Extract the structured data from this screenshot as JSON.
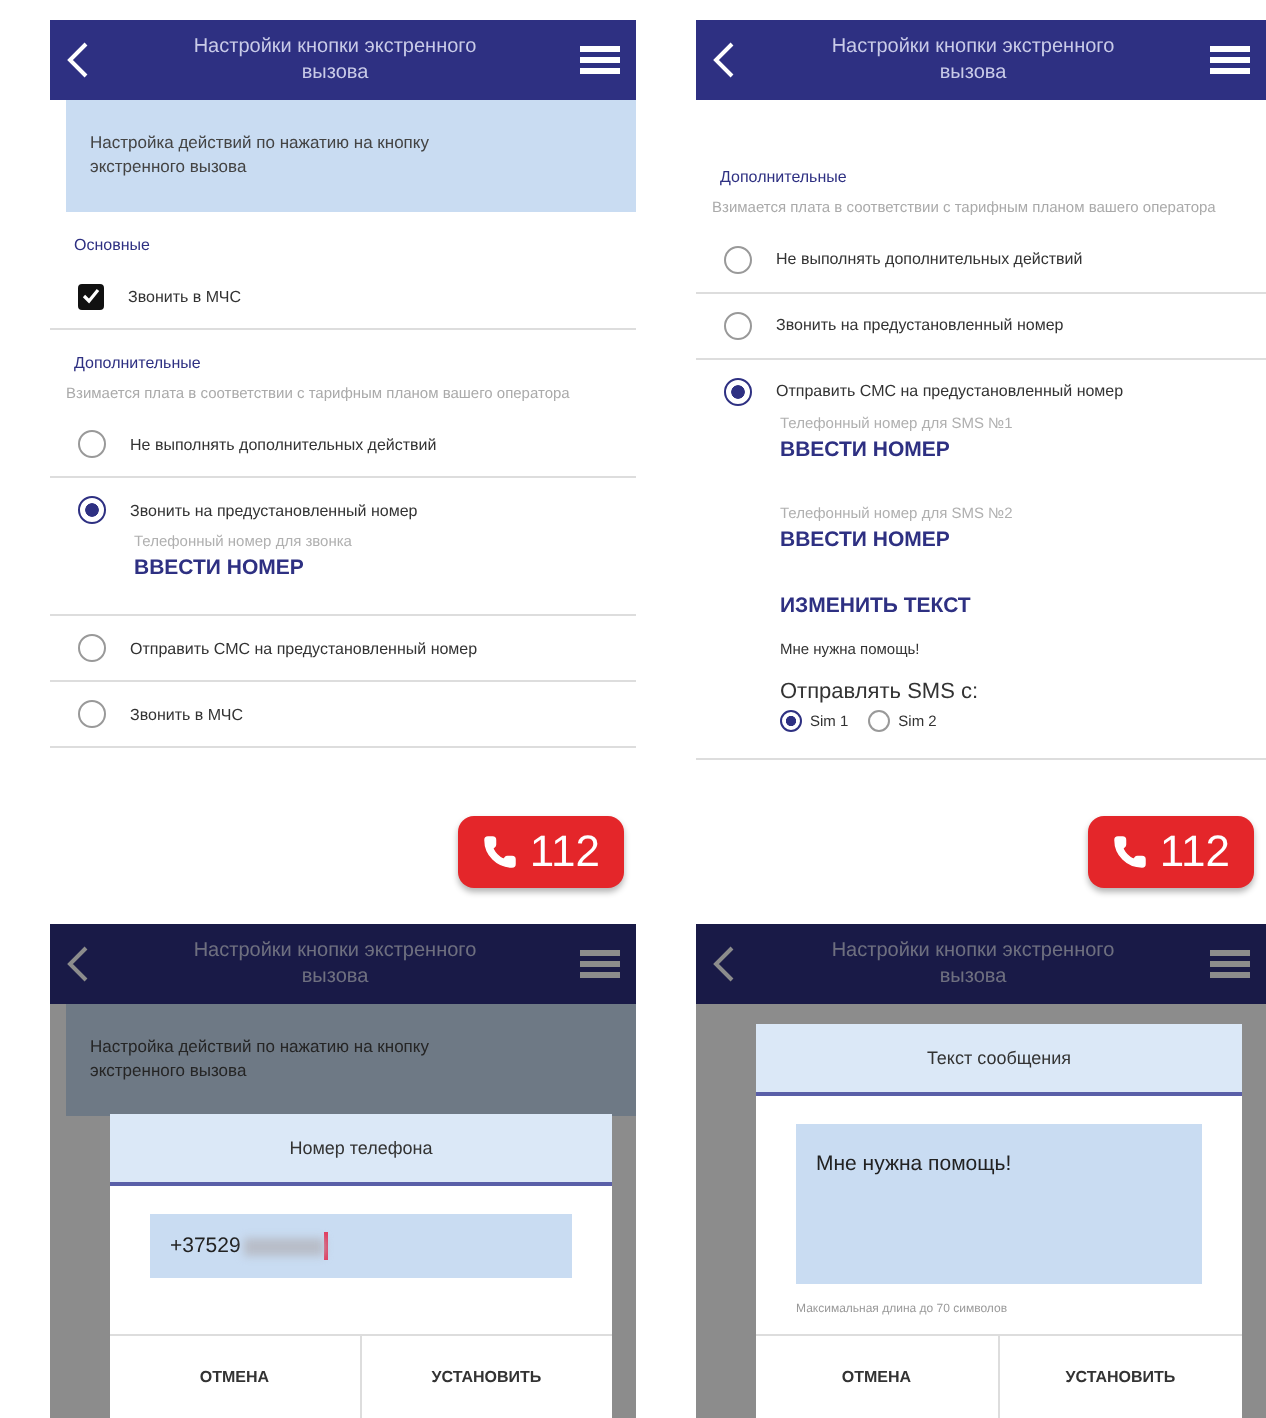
{
  "panels": [
    {
      "kind": "settings",
      "header": {
        "title": "Настройки кнопки экстренного вызова"
      },
      "banner": "Настройка действий по нажатию на кнопку экстренного вызова",
      "basic": {
        "heading": "Основные",
        "items": [
          {
            "label": "Звонить в МЧС",
            "checked": true
          }
        ]
      },
      "extra": {
        "heading": "Дополнительные",
        "note": "Взимается плата в соответствии с тарифным планом вашего оператора",
        "options": [
          {
            "label": "Не выполнять дополнительных действий",
            "selected": false
          },
          {
            "label": "Звонить на предустановленный номер",
            "selected": true,
            "children": [
              {
                "kind": "hint",
                "text": "Телефонный номер для звонка"
              },
              {
                "kind": "action",
                "text": "ВВЕСТИ НОМЕР"
              }
            ]
          },
          {
            "label": "Отправить СМС на предустановленный номер",
            "selected": false
          },
          {
            "label": "Звонить в МЧС",
            "selected": false
          }
        ]
      },
      "call_button": "112"
    },
    {
      "kind": "settings",
      "header": {
        "title": "Настройки кнопки экстренного вызова"
      },
      "extra": {
        "heading": "Дополнительные",
        "note": "Взимается плата в соответствии с тарифным планом вашего оператора",
        "options": [
          {
            "label": "Не выполнять дополнительных действий",
            "selected": false
          },
          {
            "label": "Звонить на предустановленный номер",
            "selected": false
          },
          {
            "label": "Отправить СМС на предустановленный номер",
            "selected": true,
            "children": [
              {
                "kind": "hint",
                "text": "Телефонный номер для SMS №1"
              },
              {
                "kind": "action",
                "text": "ВВЕСТИ НОМЕР"
              },
              {
                "kind": "hint",
                "text": "Телефонный номер для SMS №2"
              },
              {
                "kind": "action",
                "text": "ВВЕСТИ НОМЕР"
              },
              {
                "kind": "action",
                "text": "ИЗМЕНИТЬ ТЕКСТ"
              },
              {
                "kind": "message",
                "text": "Мне нужна помощь!"
              },
              {
                "kind": "sim_choice",
                "label": "Отправлять SMS с:",
                "sims": [
                  {
                    "label": "Sim 1",
                    "selected": true
                  },
                  {
                    "label": "Sim 2",
                    "selected": false
                  }
                ]
              }
            ]
          }
        ]
      },
      "call_button": "112"
    },
    {
      "kind": "dialog",
      "header": {
        "title": "Настройки кнопки экстренного вызова"
      },
      "banner": "Настройка действий по нажатию на кнопку экстренного вызова",
      "dialog": {
        "title": "Номер телефона",
        "field": {
          "kind": "input",
          "value": "+37529",
          "redacted": true
        },
        "buttons": [
          "ОТМЕНА",
          "УСТАНОВИТЬ"
        ]
      }
    },
    {
      "kind": "dialog",
      "header": {
        "title": "Настройки кнопки экстренного вызова"
      },
      "dialog": {
        "title": "Текст сообщения",
        "field": {
          "kind": "textarea",
          "value": "Мне нужна помощь!"
        },
        "hint": "Максимальная длина до 70 символов",
        "buttons": [
          "ОТМЕНА",
          "УСТАНОВИТЬ"
        ]
      }
    }
  ]
}
